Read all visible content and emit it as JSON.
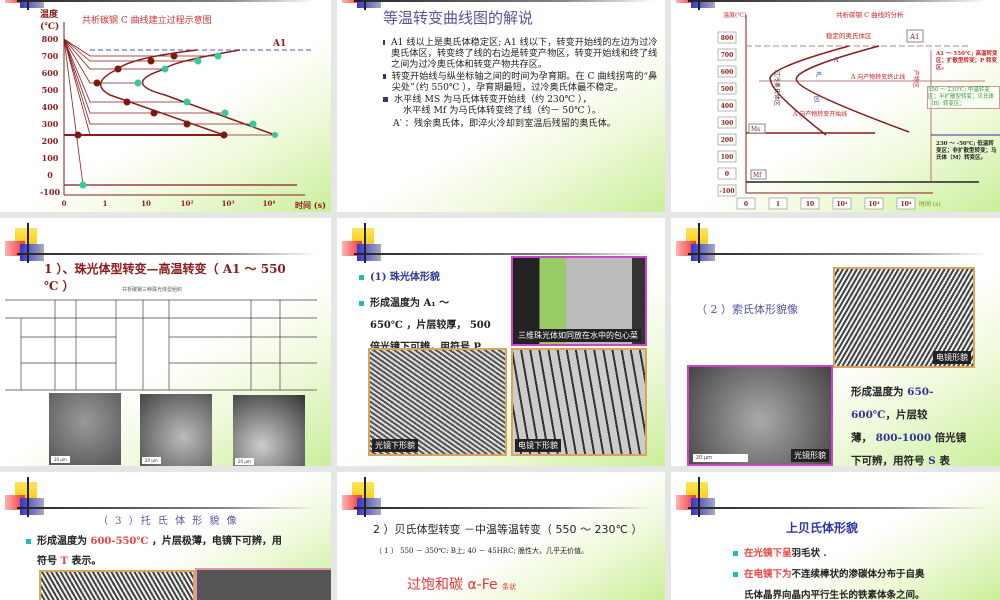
{
  "slide1": {
    "title": "共析碳钢  C 曲线建立过程示意图",
    "ylabel": "温度\n(℃)",
    "ylabel1": "温度",
    "ylabel2": "(℃)",
    "xlabel": "时间 (s)",
    "a1": "A1",
    "yticks": [
      "800",
      "700",
      "600",
      "500",
      "400",
      "300",
      "200",
      "100",
      "0",
      "-100"
    ],
    "xticks": [
      "0",
      "1",
      "10",
      "10²",
      "10³",
      "10⁴"
    ]
  },
  "slide2": {
    "title": "等温转变曲线图的解说",
    "bullets": [
      "A1 线以上是奥氏体稳定区; A1 线以下，转变开始线的左边为过冷奥氏体区，转变终了线的右边是转变产物区，转变开始线和终了线之间为过冷奥氏体和转变产物共存区。",
      "转变开始线与纵坐标轴之间的时间为孕育期。在 C 曲线拐弯的“鼻尖处”（约 550℃ ），孕育期最短，过冷奥氏体最不稳定。",
      "水平线 MS 为马氏体转变开始线（约 230℃ ），"
    ],
    "line4": "水平线 Mf 为马氏体转变终了线（约－ 50℃ ）。",
    "line5": "A′ ：残余奥氏体，即淬火冷却到室温后残留的奥氏体。"
  },
  "slide3": {
    "title": "共析碳钢  C 曲线的分析",
    "ylabel": "温度(℃)",
    "yticks": [
      "800",
      "700",
      "600",
      "500",
      "400",
      "300",
      "200",
      "100",
      "0",
      "-100"
    ],
    "xticks": [
      "0",
      "1",
      "10",
      "10²",
      "10³",
      "10⁴"
    ],
    "xlabel": "时间 (s)",
    "a1": "A1",
    "ms": "Ms",
    "mf": "Mf",
    "stable": "稳定的奥氏体区",
    "supercool": "过冷奥氏体区",
    "coexist1": "A",
    "coexist2": "产",
    "coexist3": "区",
    "end_line": "A 向产物转变终止线",
    "start_line": "A 向产物转变开始线",
    "product": "产物区",
    "zone_high": "A1 ～ 550℃; 高温转变区；扩散型转变；P 转变区。",
    "zone_mid": "550 ～ 230℃; 中温转变区；半扩散型转变；贝氏体（B）转变区；",
    "zone_low": "230 ～ -50℃; 低温转变区；非扩散型转变；马氏体（M）转变区。"
  },
  "slide4": {
    "title": "1 ）、珠光体型转变—高温转变（ A1 ～ 550 ℃ ）",
    "table_caption": "共析碳钢三种珠光体型组织",
    "scale": "20 μm"
  },
  "slide5": {
    "item1": "(1)  珠光体形貌",
    "item2": "形成温度为 A₁ ～",
    "line2": "650℃ ，片层较厚， 500",
    "line3": "倍光镜下可辨，用符号 P",
    "photo_caption": "三维珠光体如同放在水中的包心菜",
    "optical": "光镜下形貌",
    "electron": "电镜下形貌"
  },
  "slide6": {
    "title": "（ 2 ）索氏体形貌像",
    "electron": "电镜形貌",
    "optical": "光镜形貌",
    "scale": "20 μm",
    "text_a": "形成温度为 ",
    "text_b": "650-",
    "text_c": "600℃",
    "text_d": "，片层较",
    "text_e": "薄， ",
    "text_f": "800-1000",
    "text_g": " 倍光镜",
    "text_h": "下可辨，用符号 ",
    "text_i": "S",
    "text_j": "  表"
  },
  "slide7": {
    "title": "（ 3 ）托 氏 体 形 貌 像",
    "text_a": "形成温度为 ",
    "text_b": "600-550℃",
    "text_c": " ，片层极薄，电镜下可辨，用",
    "text_d": "符号 ",
    "text_e": "T",
    "text_f": "  表示。"
  },
  "slide8": {
    "title": "2 ）贝氏体型转变  －中温等温转变（ 550 ～ 230℃ ）",
    "sub": "（ 1 ） 550 － 350℃: B上; 40 － 45HRC; 脆性大，几乎无价值。",
    "label": "过饱和碳 α-Fe",
    "label_small": "条状"
  },
  "slide9": {
    "title": "上贝氏体形貌",
    "b1_red": "在光镜下呈",
    "b1": "羽毛状 .",
    "b2_red": "在电镜下为",
    "b2": "不连续棒状的渗碳体分布于自奥",
    "b2_line2": "氏体晶界向晶内平行生长的铁素体条之间。"
  }
}
